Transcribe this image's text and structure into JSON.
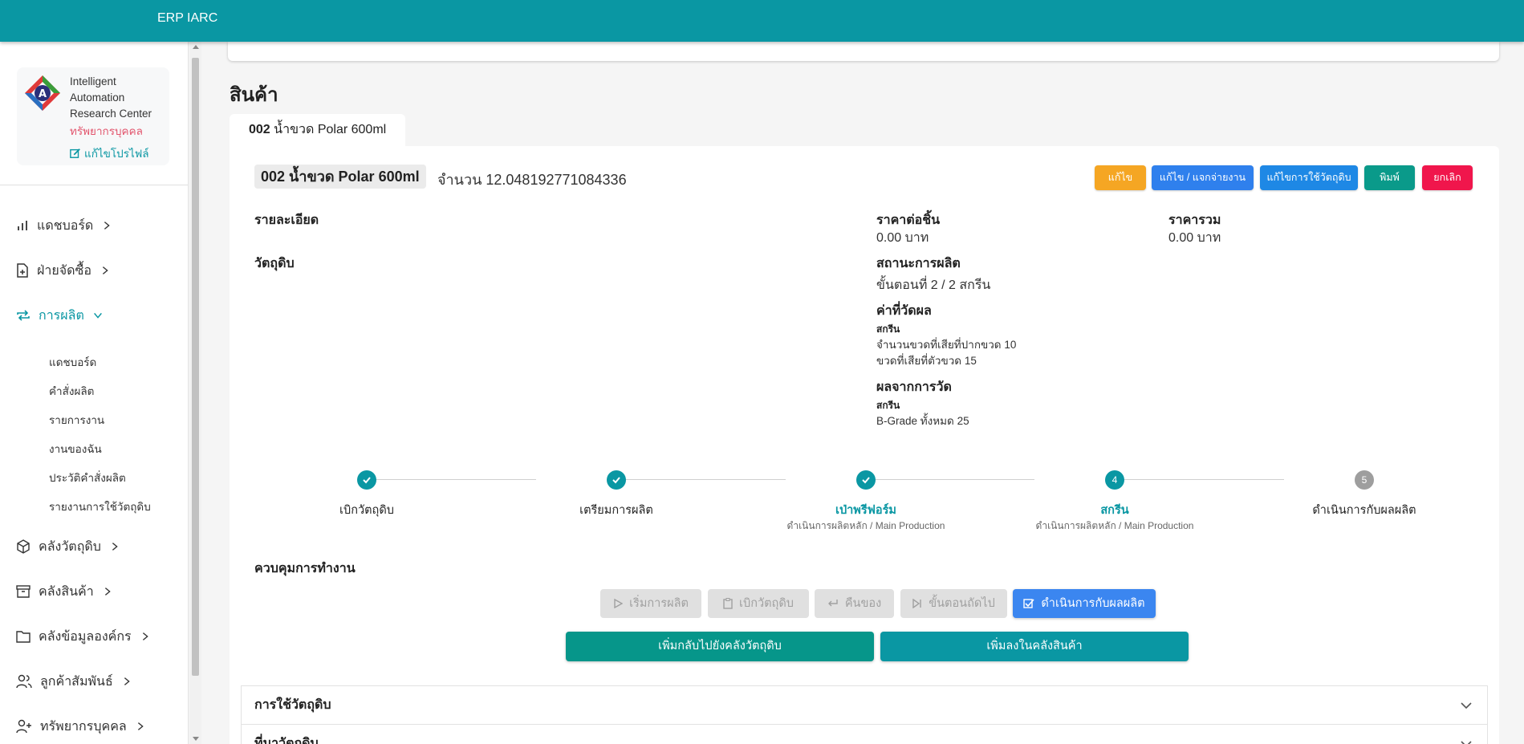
{
  "app": {
    "title": "ERP IARC"
  },
  "profile": {
    "org_name": "Intelligent Automation Research Center",
    "department": "ทรัพยากรบุคคล",
    "edit_label": "แก้ไขโปรไฟล์"
  },
  "nav": {
    "dashboard": "แดชบอร์ด",
    "purchasing": "ฝ่ายจัดซื้อ",
    "production": "การผลิต",
    "production_sub": [
      "แดชบอร์ด",
      "คำสั่งผลิต",
      "รายการงาน",
      "งานของฉัน",
      "ประวัติคำสั่งผลิต",
      "รายงานการใช้วัตถุดิบ"
    ],
    "raw_warehouse": "คลังวัตถุดิบ",
    "product_warehouse": "คลังสินค้า",
    "org_data": "คลังข้อมูลองค์กร",
    "crm": "ลูกค้าสัมพันธ์",
    "hr": "ทรัพยากรบุคคล"
  },
  "page": {
    "section_title": "สินค้า",
    "tab": {
      "code": "002",
      "name": "น้ำขวด Polar 600ml"
    }
  },
  "product": {
    "chip": "002 น้ำขวด Polar 600ml",
    "qty_label": "จำนวน",
    "qty_value": "12.048192771084336"
  },
  "actions": {
    "edit": "แก้ไข",
    "edit_assign": "แก้ไข / แจกจ่ายงาน",
    "edit_materials": "แก้ไขการใช้วัตถุดิบ",
    "print": "พิมพ์",
    "cancel": "ยกเลิก"
  },
  "details": {
    "detail_label": "รายละเอียด",
    "unit_price_label": "ราคาต่อชิ้น",
    "unit_price_value": "0.00 บาท",
    "total_price_label": "ราคารวม",
    "total_price_value": "0.00 บาท",
    "materials_label": "วัตถุดิบ",
    "status_label": "สถานะการผลิต",
    "status_value": "ขั้นตอนที่ 2 / 2 สกรีน",
    "measure_label": "ค่าที่วัดผล",
    "measure_group": "สกรีน",
    "measure_rows": [
      "จำนวนขวดที่เสียที่ปากขวด  10",
      "ขวดที่เสียที่ตัวขวด  15"
    ],
    "result_label": "ผลจากการวัด",
    "result_group": "สกรีน",
    "result_rows": [
      "B-Grade ทั้งหมด  25"
    ]
  },
  "steps": [
    {
      "label": "เบิกวัตถุดิบ",
      "sub": "",
      "state": "done",
      "num": ""
    },
    {
      "label": "เตรียมการผลิต",
      "sub": "",
      "state": "done",
      "num": ""
    },
    {
      "label": "เป่าพรีฟอร์ม",
      "sub": "ดำเนินการผลิตหลัก / Main Production",
      "state": "done-active",
      "num": ""
    },
    {
      "label": "สกรีน",
      "sub": "ดำเนินการผลิตหลัก / Main Production",
      "state": "current",
      "num": "4"
    },
    {
      "label": "ดำเนินการกับผลผลิต",
      "sub": "",
      "state": "pending",
      "num": "5"
    }
  ],
  "control": {
    "title": "ควบคุมการทำงาน",
    "start": "เริ่มการผลิต",
    "withdraw": "เบิกวัตถุดิบ",
    "return": "คืนของ",
    "next": "ขั้นตอนถัดไป",
    "process_output": "ดำเนินการกับผลผลิต",
    "add_back_raw": "เพิ่มกลับไปยังคลังวัตถุดิบ",
    "add_to_stock": "เพิ่มลงในคลังสินค้า"
  },
  "accordions": [
    "การใช้วัตถุดิบ",
    "ที่มาวัตถุดิบ"
  ],
  "colors": {
    "primary": "#0a97a3",
    "warning": "#f5a623",
    "info": "#2f80ed",
    "info2": "#1e88e5",
    "success": "#0a9a8a",
    "danger": "#f0164c",
    "green": "#06968a"
  }
}
